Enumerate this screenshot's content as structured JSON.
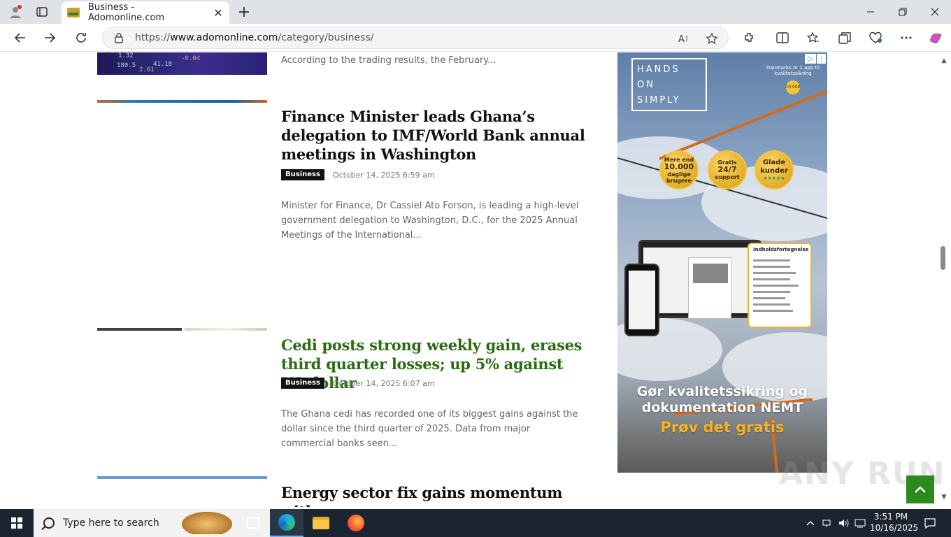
{
  "browser": {
    "tab_title": "Business - Adomonline.com",
    "url_prefix": "https://",
    "url_domain": "www.adomonline.com",
    "url_path": "/category/business/",
    "new_tab_label": "+",
    "tab_close": "✕"
  },
  "articles": [
    {
      "excerpt": "According to the trading results, the February...",
      "thumb_numbers": [
        "1.32",
        "180.5",
        "2.61",
        "41.18",
        "-0.04"
      ]
    },
    {
      "title": "Finance Minister leads Ghana’s delegation to IMF/World Bank annual meetings in Washington",
      "category": "Business",
      "date": "October 14, 2025 6:59 am",
      "excerpt": "Minister for Finance, Dr Cassiel Ato Forson, is leading a high-level government delegation to Washington, D.C., for the 2025 Annual Meetings of the International..."
    },
    {
      "title": "Cedi posts strong weekly gain, erases third quarter losses; up 5% against US dollar",
      "category": "Business",
      "date": "October 14, 2025 6:07 am",
      "excerpt": "The Ghana cedi has recorded one of its biggest gains against the dollar since the third quarter of 2025. Data from major commercial banks seen..."
    },
    {
      "title": "Energy sector fix gains momentum with"
    }
  ],
  "ad": {
    "logo_line1": "HANDS",
    "logo_line2": "ON",
    "logo_line3": "SIMPLY",
    "award_text": "Danmarks nr 1 app til kvalitetssikring",
    "award_badge": "10.000",
    "seal1_top": "Mere end",
    "seal1_big": "10.000",
    "seal1_bottom": "daglige brugere",
    "seal2_top": "Gratis",
    "seal2_big": "24/7",
    "seal2_bottom": "support",
    "seal3_big": "Glade kunder",
    "toc_title": "Indholdsfortegnelse",
    "headline": "Gør kvalitetssikring og dokumentation NEMT",
    "cta": "Prøv det gratis",
    "adchoices": "▷",
    "admenu": "⋮"
  },
  "watermark": "ANY RUN",
  "taskbar": {
    "search_placeholder": "Type here to search",
    "time": "3:51 PM",
    "date": "10/16/2025"
  },
  "colors": {
    "headline_highlight": "#2a6b12",
    "back_to_top": "#2a8a1e",
    "badge_bg": "#111111",
    "taskbar_bg": "#1b2430"
  }
}
